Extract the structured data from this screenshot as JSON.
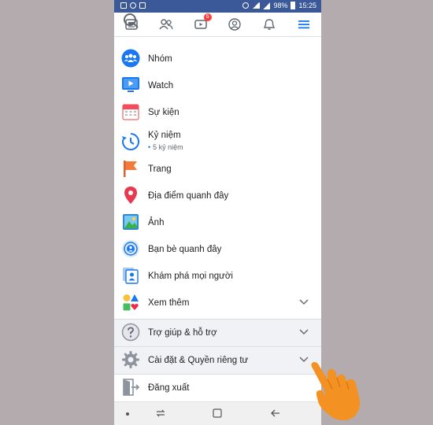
{
  "status_bar": {
    "battery": "98%",
    "time": "15:25"
  },
  "top_nav": {
    "tabs": [
      {
        "name": "news-feed",
        "icon": "newspaper-icon"
      },
      {
        "name": "friends",
        "icon": "friends-icon"
      },
      {
        "name": "watch",
        "icon": "video-icon",
        "badge": "6"
      },
      {
        "name": "profile",
        "icon": "profile-icon"
      },
      {
        "name": "notifications",
        "icon": "bell-icon"
      },
      {
        "name": "menu",
        "icon": "hamburger-icon",
        "active": true
      }
    ]
  },
  "menu": {
    "items": [
      {
        "label": "Nhóm",
        "icon": "groups-icon"
      },
      {
        "label": "Watch",
        "icon": "watch-icon"
      },
      {
        "label": "Sự kiện",
        "icon": "calendar-icon"
      },
      {
        "label": "Kỷ niệm",
        "sub": "5 kỷ niệm",
        "icon": "memories-clock-icon"
      },
      {
        "label": "Trang",
        "icon": "flag-icon"
      },
      {
        "label": "Địa điểm quanh đây",
        "icon": "location-pin-icon"
      },
      {
        "label": "Ảnh",
        "icon": "photos-icon"
      },
      {
        "label": "Bạn bè quanh đây",
        "icon": "nearby-friends-icon"
      },
      {
        "label": "Khám phá mọi người",
        "icon": "discover-people-icon"
      },
      {
        "label": "Xem thêm",
        "icon": "see-more-shapes-icon"
      }
    ],
    "help": {
      "label": "Trợ giúp & hỗ trợ",
      "icon": "question-mark-icon"
    },
    "settings": {
      "label": "Cài đặt & Quyền riêng tư",
      "icon": "gear-icon"
    },
    "logout": {
      "label": "Đăng xuất",
      "icon": "logout-door-icon"
    }
  },
  "colors": {
    "status_bar": "#3b5998",
    "accent": "#1877f2",
    "badge": "#fa3e3e",
    "section_bg": "#f0f2f5",
    "hand": "#f39222",
    "page_bg": "#b3abad"
  }
}
